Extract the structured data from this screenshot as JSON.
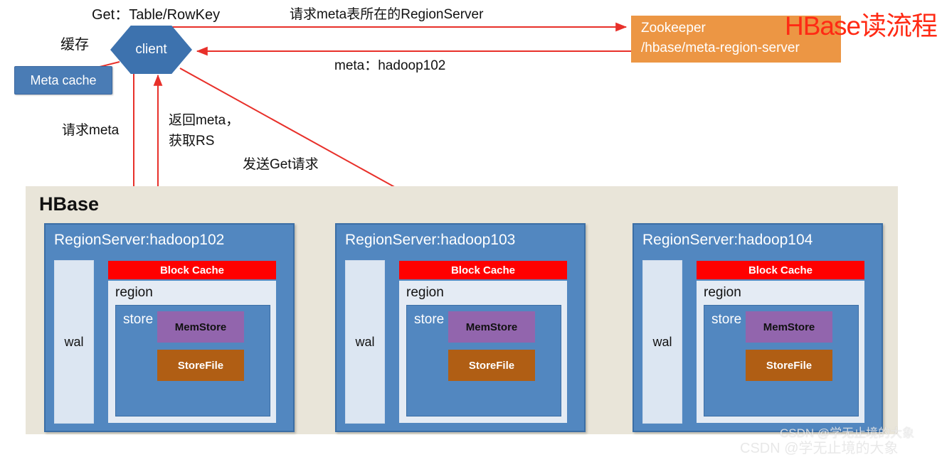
{
  "title": "HBase读流程",
  "colors": {
    "title_red": "#FF2A14",
    "zookeeper_orange": "#EC9644",
    "region_server_blue": "#5287C0",
    "client_blue": "#3D72AE",
    "meta_cache_blue": "#4A7CB5",
    "block_cache_red": "#FF0000",
    "memstore_purple": "#9265AD",
    "storefile_brown": "#B05E14",
    "wal_light": "#DCE6F2",
    "hbase_bg": "#E9E5D9",
    "red_arrow": "#E8302A",
    "black_arrow": "#111111"
  },
  "client": {
    "label": "client"
  },
  "meta_cache": {
    "label": "Meta cache"
  },
  "zookeeper": {
    "line1": "Zookeeper",
    "line2": "/hbase/meta-region-server"
  },
  "labels": {
    "get": "Get：Table/RowKey",
    "request_region_server": "请求meta表所在的RegionServer",
    "meta_hadoop": "meta：hadoop102",
    "cache": "缓存",
    "request_meta": "请求meta",
    "return_meta_line1": "返回meta，",
    "return_meta_line2": "获取RS",
    "send_get": "发送Get请求"
  },
  "hbase": {
    "title": "HBase",
    "region_servers": [
      {
        "title": "RegionServer:hadoop102",
        "wal": "wal",
        "block_cache": "Block Cache",
        "region": "region",
        "store": "store",
        "memstore": "MemStore",
        "storefile": "StoreFile"
      },
      {
        "title": "RegionServer:hadoop103",
        "wal": "wal",
        "block_cache": "Block Cache",
        "region": "region",
        "store": "store",
        "memstore": "MemStore",
        "storefile": "StoreFile"
      },
      {
        "title": "RegionServer:hadoop104",
        "wal": "wal",
        "block_cache": "Block Cache",
        "region": "region",
        "store": "store",
        "memstore": "MemStore",
        "storefile": "StoreFile"
      }
    ]
  },
  "watermark": "CSDN @学无止境的大象"
}
